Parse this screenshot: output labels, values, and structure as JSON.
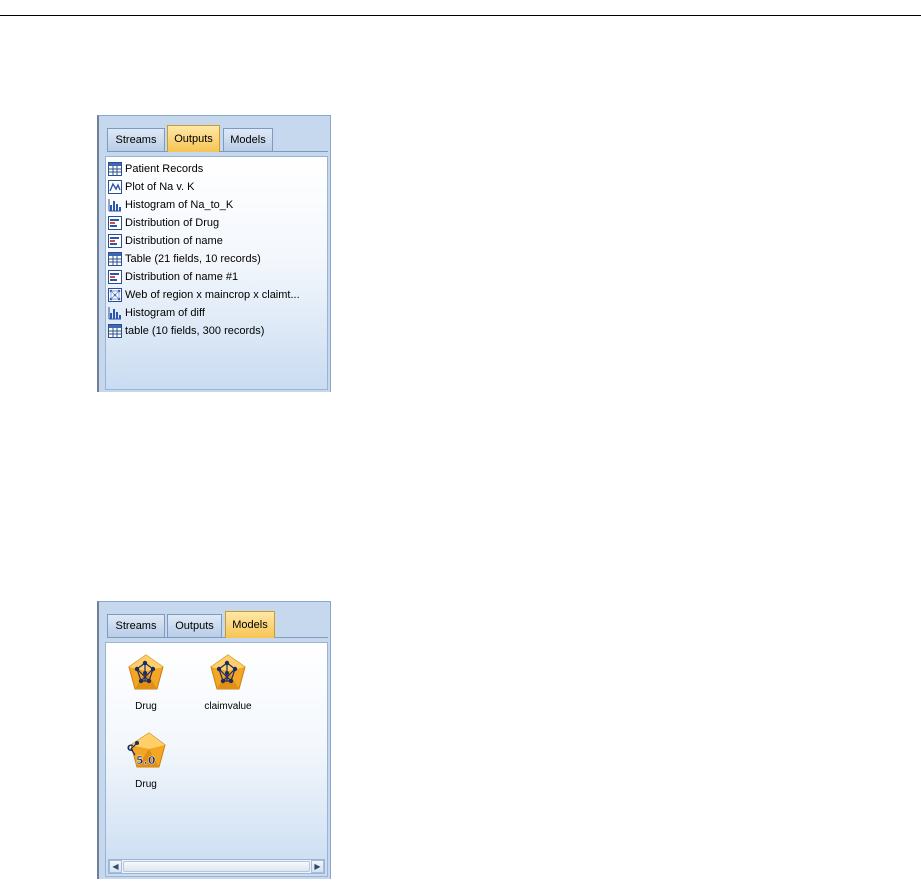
{
  "outputs_panel": {
    "tabs": [
      {
        "label": "Streams",
        "active": false
      },
      {
        "label": "Outputs",
        "active": true
      },
      {
        "label": "Models",
        "active": false
      }
    ],
    "items": [
      {
        "label": "Patient Records",
        "icon": "table-icon"
      },
      {
        "label": "Plot of Na v. K",
        "icon": "plot-icon"
      },
      {
        "label": "Histogram of Na_to_K",
        "icon": "histogram-icon"
      },
      {
        "label": "Distribution of Drug",
        "icon": "distribution-icon"
      },
      {
        "label": "Distribution of name",
        "icon": "distribution-icon"
      },
      {
        "label": "Table (21 fields, 10 records)",
        "icon": "table-icon"
      },
      {
        "label": "Distribution of name #1",
        "icon": "distribution-icon"
      },
      {
        "label": "Web of region x maincrop x claimt...",
        "icon": "web-icon"
      },
      {
        "label": "Histogram of diff",
        "icon": "histogram-icon"
      },
      {
        "label": "table (10 fields, 300 records)",
        "icon": "table-icon"
      }
    ]
  },
  "models_panel": {
    "tabs": [
      {
        "label": "Streams",
        "active": false
      },
      {
        "label": "Outputs",
        "active": false
      },
      {
        "label": "Models",
        "active": true
      }
    ],
    "models": [
      {
        "label": "Drug",
        "icon": "neural-net-model-icon"
      },
      {
        "label": "claimvalue",
        "icon": "neural-net-model-icon"
      },
      {
        "label": "Drug",
        "icon": "c50-model-icon",
        "badge": "5.0",
        "badge_prefix": "C"
      }
    ]
  },
  "colors": {
    "active_tab": "#f6c453",
    "panel_bg": "#c6d8ee",
    "gem": "#f2a623"
  }
}
